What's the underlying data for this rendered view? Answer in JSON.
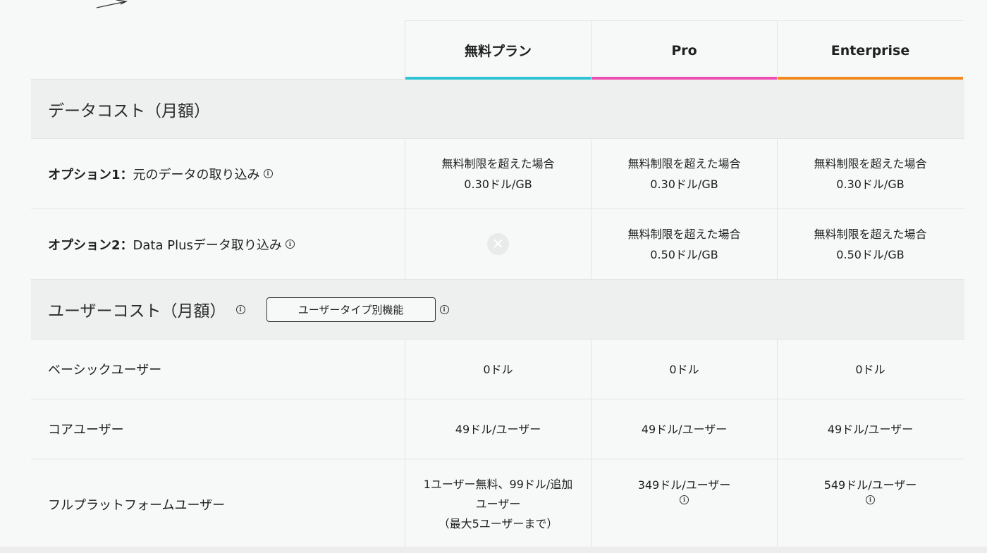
{
  "plans": [
    {
      "name": "無料プラン",
      "accent": "#2fc4d4"
    },
    {
      "name": "Pro",
      "accent": "#ee4fb3"
    },
    {
      "name": "Enterprise",
      "accent": "#f0891e"
    }
  ],
  "data_cost": {
    "title": "データコスト（月額）",
    "rows": [
      {
        "label_bold": "オプション1：",
        "label_text": "元のデータの取り込み",
        "cells": [
          [
            "無料制限を超えた場合",
            "0.30ドル/GB"
          ],
          [
            "無料制限を超えた場合",
            "0.30ドル/GB"
          ],
          [
            "無料制限を超えた場合",
            "0.30ドル/GB"
          ]
        ]
      },
      {
        "label_bold": "オプション2：",
        "label_text": "Data Plusデータ取り込み",
        "cells": [
          [
            "無料制限を超えた場合",
            "0.50ドル/GB"
          ],
          [
            "無料制限を超えた場合",
            "0.50ドル/GB"
          ]
        ]
      }
    ]
  },
  "user_cost": {
    "title": "ユーザーコスト（月額）",
    "button_label": "ユーザータイプ別機能",
    "rows": [
      {
        "label": "ベーシックユーザー",
        "cells": [
          "0ドル",
          "0ドル",
          "0ドル"
        ]
      },
      {
        "label": "コアユーザー",
        "cells": [
          "49ドル/ユーザー",
          "49ドル/ユーザー",
          "49ドル/ユーザー"
        ]
      },
      {
        "label": "フルプラットフォームユーザー",
        "cells": [
          [
            "1ユーザー無料、99ドル/追加",
            "ユーザー",
            "（最大5ユーザーまで）"
          ],
          [
            "349ドル/ユーザー"
          ],
          [
            "549ドル/ユーザー"
          ]
        ]
      }
    ]
  }
}
